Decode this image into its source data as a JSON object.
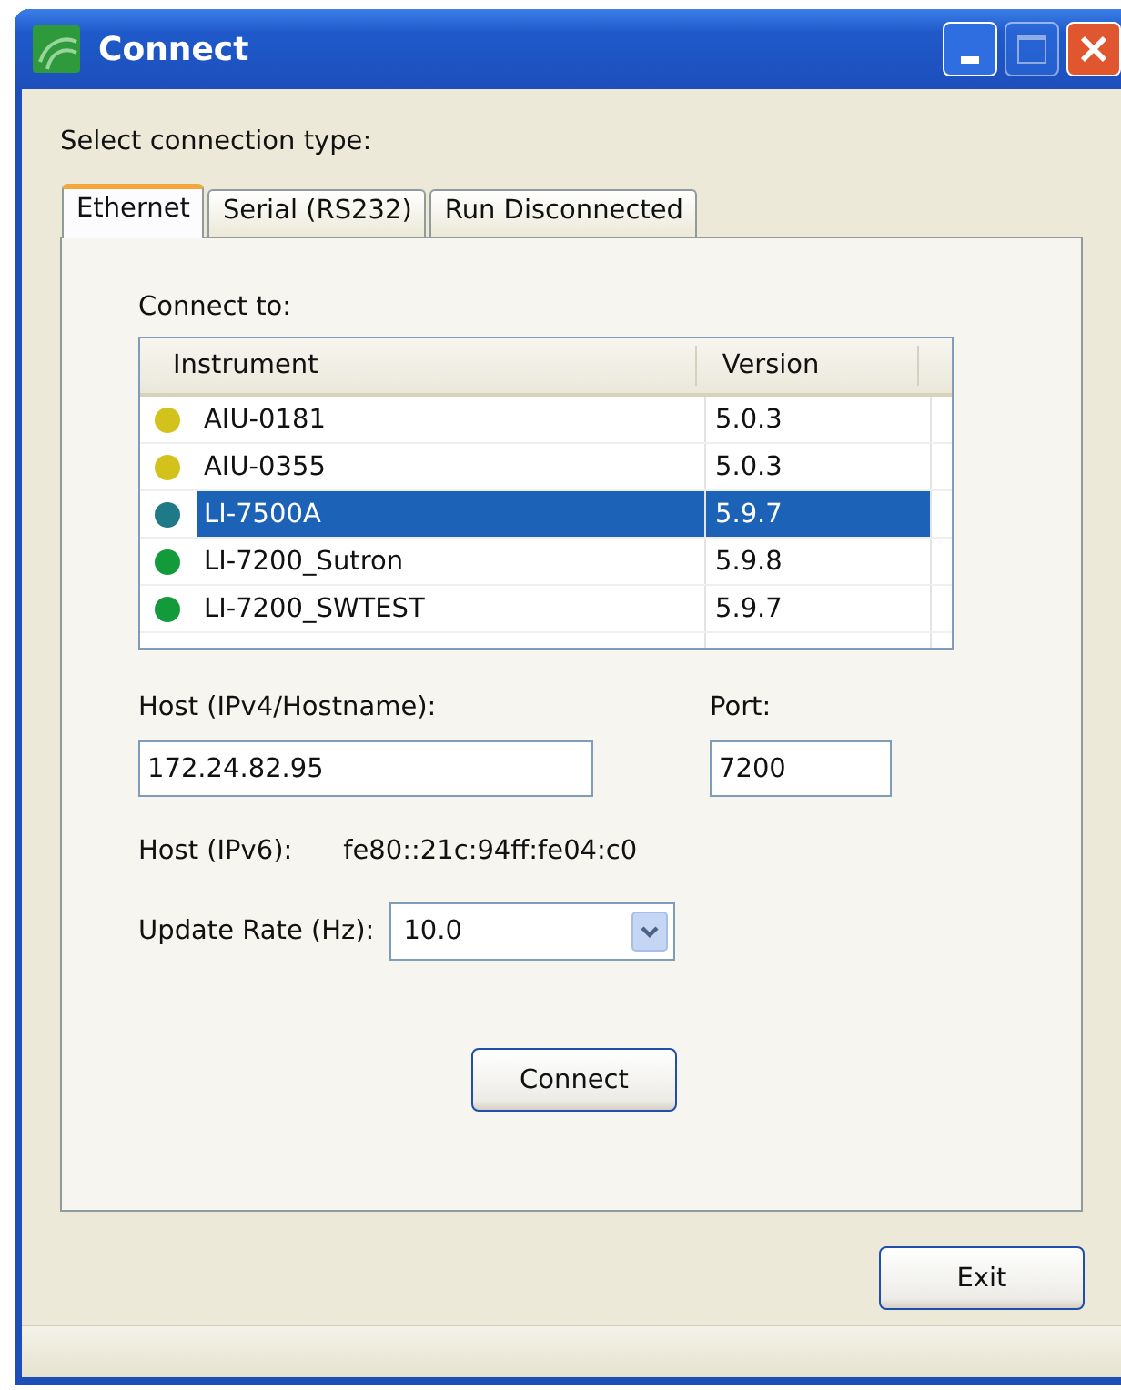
{
  "window": {
    "title": "Connect"
  },
  "prompt": "Select connection type:",
  "tabs": [
    {
      "label": "Ethernet",
      "selected": true
    },
    {
      "label": "Serial (RS232)",
      "selected": false
    },
    {
      "label": "Run Disconnected",
      "selected": false
    }
  ],
  "connect_to": {
    "label": "Connect to:",
    "columns": [
      "Instrument",
      "Version"
    ],
    "rows": [
      {
        "instrument": "AIU-0181",
        "version": "5.0.3",
        "color": "#d4c21c",
        "selected": false
      },
      {
        "instrument": "AIU-0355",
        "version": "5.0.3",
        "color": "#d4c21c",
        "selected": false
      },
      {
        "instrument": "LI-7500A",
        "version": "5.9.7",
        "color": "#1e7a86",
        "selected": true
      },
      {
        "instrument": "LI-7200_Sutron",
        "version": "5.9.8",
        "color": "#139a3a",
        "selected": false
      },
      {
        "instrument": "LI-7200_SWTEST",
        "version": "5.9.7",
        "color": "#139a3a",
        "selected": false
      }
    ]
  },
  "host": {
    "label": "Host (IPv4/Hostname):",
    "value": "172.24.82.95"
  },
  "port": {
    "label": "Port:",
    "value": "7200"
  },
  "ipv6": {
    "label": "Host (IPv6):",
    "value": "fe80::21c:94ff:fe04:c0"
  },
  "update_rate": {
    "label": "Update Rate (Hz):",
    "value": "10.0"
  },
  "connect_button": "Connect",
  "exit_button": "Exit"
}
